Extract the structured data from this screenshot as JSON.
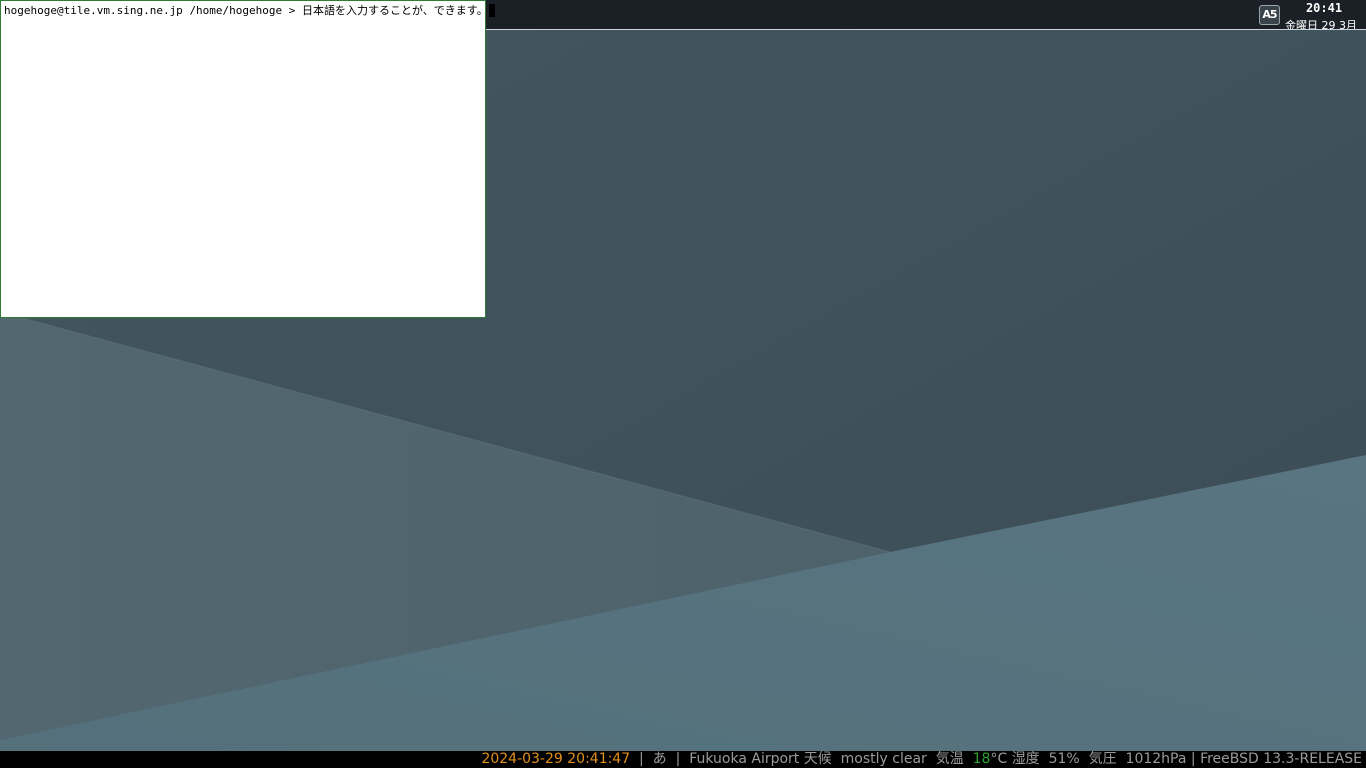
{
  "colors": {
    "wallpaper_dark": "#3f515c",
    "wallpaper_mid": "#51656f",
    "wallpaper_light": "#56727d",
    "panel_bg": "#1a2025",
    "terminal_border": "#2e7d32",
    "status_datetime": "#e0901c",
    "status_temp": "#2ea02e",
    "status_text": "#9a9a9a"
  },
  "top_panel": {
    "tray_icon": {
      "name": "input-method-icon",
      "label": "A5"
    },
    "clock_time": "20:41",
    "clock_date": "金曜日 29 3月"
  },
  "terminal": {
    "prompt_host": "hogehoge@tile.vm.sing.ne.jp",
    "prompt_path": "/home/hogehoge",
    "prompt_symbol": ">",
    "input_text": "日本語を入力することが、できます。"
  },
  "status_bar": {
    "datetime": "2024-03-29 20:41:47",
    "sep1": "|",
    "ime_mode": "あ",
    "sep2": "|",
    "location": "Fukuoka Airport",
    "weather_label": "天候",
    "weather_value": "mostly clear",
    "temp_label": "気温",
    "temp_value": "18",
    "temp_unit": "°C",
    "humidity_label": "湿度",
    "humidity_value": "51%",
    "pressure_label": "気圧",
    "pressure_value": "1012hPa",
    "sep3": "|",
    "os": "FreeBSD 13.3-RELEASE"
  }
}
